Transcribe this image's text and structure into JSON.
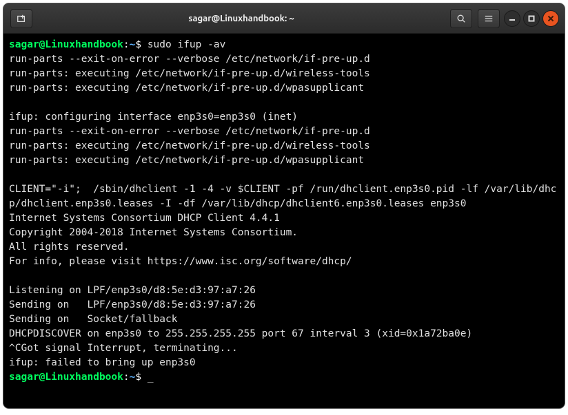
{
  "titlebar": {
    "title": "sagar@Linuxhandbook: ~",
    "newtab_icon": "new-tab",
    "search_icon": "search",
    "menu_icon": "hamburger",
    "minimize_icon": "minimize",
    "maximize_icon": "maximize",
    "close_icon": "close"
  },
  "prompt": {
    "user_host": "sagar@Linuxhandbook",
    "colon": ":",
    "path": "~",
    "dollar": "$ "
  },
  "command1": "sudo ifup -av",
  "output_lines": [
    "run-parts --exit-on-error --verbose /etc/network/if-pre-up.d",
    "run-parts: executing /etc/network/if-pre-up.d/wireless-tools",
    "run-parts: executing /etc/network/if-pre-up.d/wpasupplicant",
    "",
    "ifup: configuring interface enp3s0=enp3s0 (inet)",
    "run-parts --exit-on-error --verbose /etc/network/if-pre-up.d",
    "run-parts: executing /etc/network/if-pre-up.d/wireless-tools",
    "run-parts: executing /etc/network/if-pre-up.d/wpasupplicant",
    "",
    "CLIENT=\"-i\";  /sbin/dhclient -1 -4 -v $CLIENT -pf /run/dhclient.enp3s0.pid -lf /var/lib/dhcp/dhclient.enp3s0.leases -I -df /var/lib/dhcp/dhclient6.enp3s0.leases enp3s0",
    "Internet Systems Consortium DHCP Client 4.4.1",
    "Copyright 2004-2018 Internet Systems Consortium.",
    "All rights reserved.",
    "For info, please visit https://www.isc.org/software/dhcp/",
    "",
    "Listening on LPF/enp3s0/d8:5e:d3:97:a7:26",
    "Sending on   LPF/enp3s0/d8:5e:d3:97:a7:26",
    "Sending on   Socket/fallback",
    "DHCPDISCOVER on enp3s0 to 255.255.255.255 port 67 interval 3 (xid=0x1a72ba0e)",
    "^CGot signal Interrupt, terminating...",
    "ifup: failed to bring up enp3s0"
  ],
  "cursor_char": "_"
}
